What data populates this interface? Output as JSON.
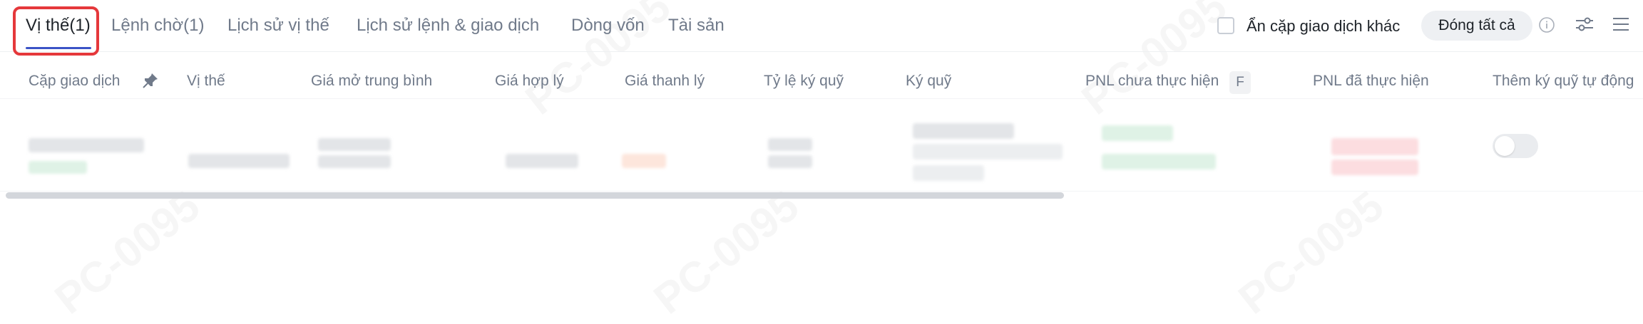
{
  "tabs": [
    {
      "label": "Vị thế(1)",
      "active": true
    },
    {
      "label": "Lệnh chờ(1)"
    },
    {
      "label": "Lịch sử vị thế"
    },
    {
      "label": "Lịch sử lệnh & giao dịch"
    },
    {
      "label": "Dòng vốn"
    },
    {
      "label": "Tài sản"
    }
  ],
  "controls": {
    "hide_other_pairs_label": "Ẩn cặp giao dịch khác",
    "hide_other_pairs_checked": false,
    "close_all_label": "Đóng tất cả",
    "icons": [
      "info-icon",
      "filter-sliders-icon",
      "menu-icon"
    ]
  },
  "table": {
    "columns": [
      "Cặp giao dịch",
      "Vị thế",
      "Giá mở trung bình",
      "Giá hợp lý",
      "Giá thanh lý",
      "Tỷ lệ ký quỹ",
      "Ký quỹ",
      "PNL chưa thực hiện",
      "PNL đã thực hiện",
      "Thêm ký quỹ tự động"
    ],
    "pnl_badge": "F",
    "pin_icon": "pin-icon",
    "auto_margin_enabled": false
  },
  "watermark": "PC-0095",
  "colors": {
    "accent": "#3b53c6",
    "highlight_box": "#e5383b",
    "profit": "#2ebd85",
    "loss": "#f6465d"
  }
}
